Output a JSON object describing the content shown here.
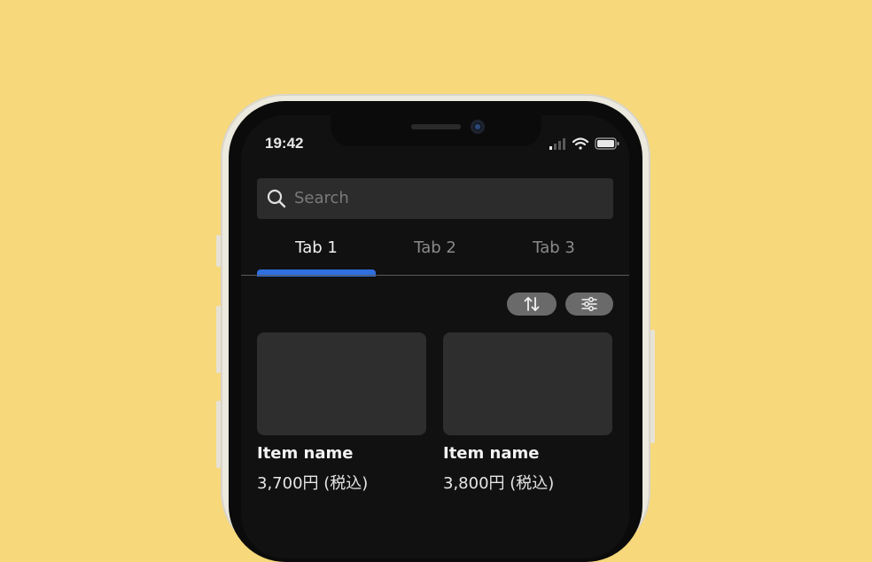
{
  "status_bar": {
    "time": "19:42"
  },
  "search": {
    "placeholder": "Search"
  },
  "tabs": [
    {
      "label": "Tab 1",
      "active": true
    },
    {
      "label": "Tab 2",
      "active": false
    },
    {
      "label": "Tab 3",
      "active": false
    }
  ],
  "toolbar": {
    "sort_icon": "sort-arrows-icon",
    "filter_icon": "sliders-icon"
  },
  "items": [
    {
      "name": "Item name",
      "price": "3,700円 (税込)"
    },
    {
      "name": "Item name",
      "price": "3,800円 (税込)"
    }
  ],
  "colors": {
    "background": "#F7D87A",
    "screen": "#111111",
    "accent": "#2F6FE0"
  }
}
